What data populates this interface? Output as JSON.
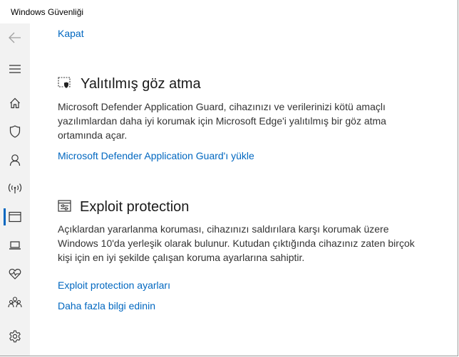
{
  "window": {
    "title": "Windows Güvenliği"
  },
  "sidebar": {
    "items": [
      {
        "icon": "back-arrow-icon"
      },
      {
        "icon": "hamburger-menu-icon"
      },
      {
        "icon": "home-icon"
      },
      {
        "icon": "shield-icon"
      },
      {
        "icon": "person-icon"
      },
      {
        "icon": "wireless-icon"
      },
      {
        "icon": "app-browser-icon",
        "selected": true
      },
      {
        "icon": "laptop-icon"
      },
      {
        "icon": "heart-pulse-icon"
      },
      {
        "icon": "family-icon"
      },
      {
        "icon": "gear-icon"
      }
    ]
  },
  "main": {
    "close_link": "Kapat",
    "isolated_browsing": {
      "icon": "isolated-browsing-icon",
      "heading": "Yalıtılmış göz atma",
      "description": "Microsoft Defender Application Guard, cihazınızı ve verilerinizi kötü amaçlı yazılımlardan daha iyi korumak için Microsoft Edge'i yalıtılmış bir göz atma ortamında açar.",
      "link": "Microsoft Defender Application Guard'ı yükle"
    },
    "exploit_protection": {
      "icon": "exploit-protection-icon",
      "heading": "Exploit protection",
      "description": "Açıklardan yararlanma koruması, cihazınızı saldırılara karşı korumak üzere Windows 10'da yerleşik olarak bulunur. Kutudan çıktığında cihazınız zaten birçok kişi için en iyi şekilde çalışan koruma ayarlarına sahiptir.",
      "settings_link": "Exploit protection ayarları",
      "learn_more_link": "Daha fazla bilgi edinin"
    }
  }
}
